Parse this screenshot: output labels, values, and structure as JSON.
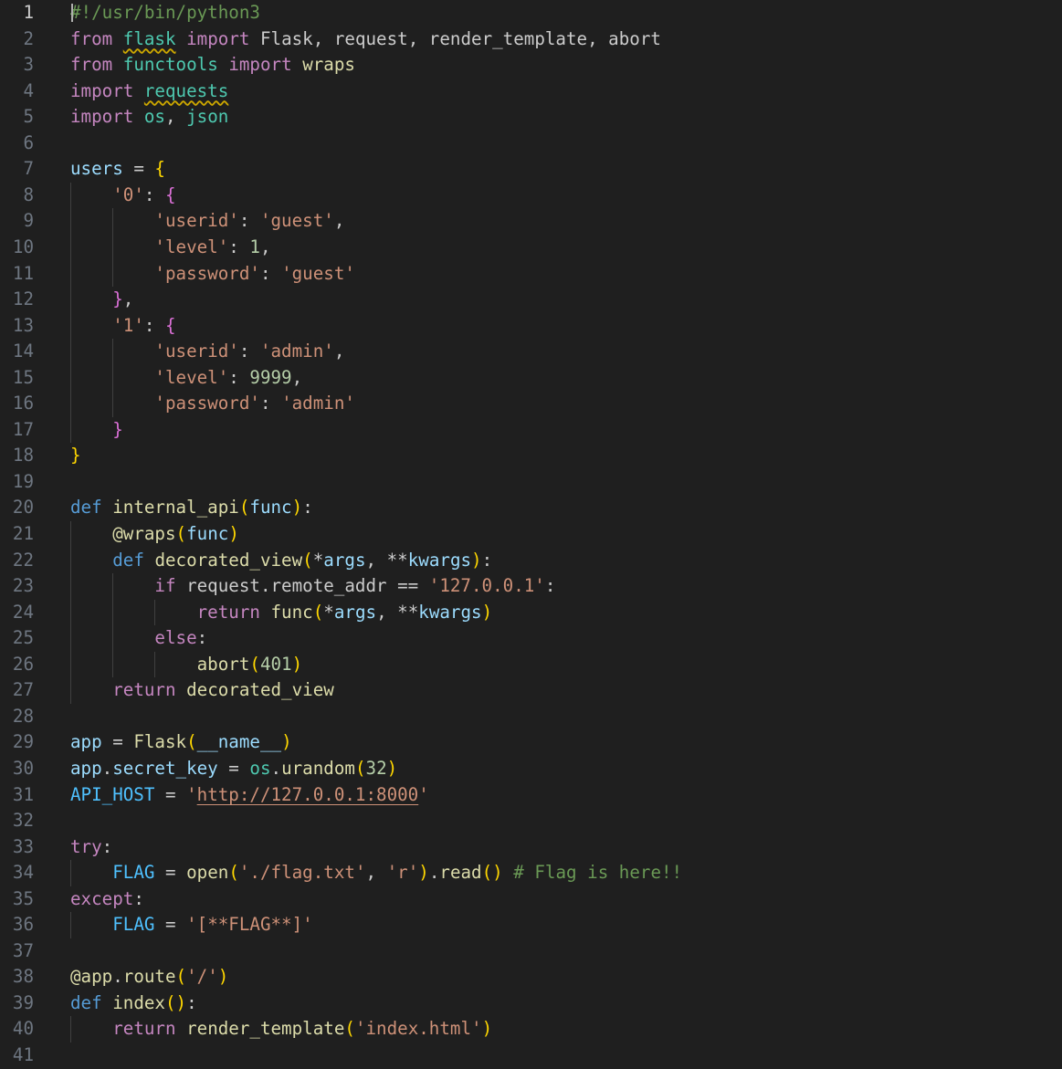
{
  "editor": {
    "language": "python",
    "colors": {
      "background": "#1f1f1f",
      "line_number": "#6e7681",
      "current_line_number": "#cccccc",
      "keyword": "#c586c0",
      "storage": "#569cd6",
      "function": "#dcdcaa",
      "module": "#4ec9b0",
      "variable": "#9cdcfe",
      "string": "#ce9178",
      "number": "#b5cea8",
      "comment": "#6a9955",
      "constant": "#4fc1ff",
      "bracket_level_1": "#ffd700",
      "bracket_level_2": "#da70d6",
      "bracket_level_3": "#179fff",
      "indent_guide": "#404040",
      "warning_squiggle": "#cca700"
    },
    "current_line": 1,
    "lines": [
      {
        "number": "1",
        "tokens": [
          {
            "t": "#!/usr/bin/python3",
            "c": "comment"
          }
        ]
      },
      {
        "number": "2",
        "tokens": [
          {
            "t": "from",
            "c": "keyword"
          },
          {
            "t": " "
          },
          {
            "t": "flask",
            "c": "module",
            "warn": true
          },
          {
            "t": " "
          },
          {
            "t": "import",
            "c": "keyword"
          },
          {
            "t": " Flask, request, render_template, abort"
          }
        ]
      },
      {
        "number": "3",
        "tokens": [
          {
            "t": "from",
            "c": "keyword"
          },
          {
            "t": " "
          },
          {
            "t": "functools",
            "c": "module"
          },
          {
            "t": " "
          },
          {
            "t": "import",
            "c": "keyword"
          },
          {
            "t": " "
          },
          {
            "t": "wraps",
            "c": "function"
          }
        ]
      },
      {
        "number": "4",
        "tokens": [
          {
            "t": "import",
            "c": "keyword"
          },
          {
            "t": " "
          },
          {
            "t": "requests",
            "c": "module",
            "warn": true
          }
        ]
      },
      {
        "number": "5",
        "tokens": [
          {
            "t": "import",
            "c": "keyword"
          },
          {
            "t": " "
          },
          {
            "t": "os",
            "c": "module"
          },
          {
            "t": ", "
          },
          {
            "t": "json",
            "c": "module"
          }
        ]
      },
      {
        "number": "6",
        "tokens": []
      },
      {
        "number": "7",
        "tokens": [
          {
            "t": "users",
            "c": "variable"
          },
          {
            "t": " = "
          },
          {
            "t": "{",
            "c": "brace-1"
          }
        ]
      },
      {
        "number": "8",
        "tokens": [
          {
            "t": "    "
          },
          {
            "t": "'0'",
            "c": "string"
          },
          {
            "t": ": "
          },
          {
            "t": "{",
            "c": "brace-2"
          }
        ]
      },
      {
        "number": "9",
        "tokens": [
          {
            "t": "        "
          },
          {
            "t": "'userid'",
            "c": "string"
          },
          {
            "t": ": "
          },
          {
            "t": "'guest'",
            "c": "string"
          },
          {
            "t": ","
          }
        ]
      },
      {
        "number": "10",
        "tokens": [
          {
            "t": "        "
          },
          {
            "t": "'level'",
            "c": "string"
          },
          {
            "t": ": "
          },
          {
            "t": "1",
            "c": "number"
          },
          {
            "t": ","
          }
        ]
      },
      {
        "number": "11",
        "tokens": [
          {
            "t": "        "
          },
          {
            "t": "'password'",
            "c": "string"
          },
          {
            "t": ": "
          },
          {
            "t": "'guest'",
            "c": "string"
          }
        ]
      },
      {
        "number": "12",
        "tokens": [
          {
            "t": "    "
          },
          {
            "t": "}",
            "c": "brace-2"
          },
          {
            "t": ","
          }
        ]
      },
      {
        "number": "13",
        "tokens": [
          {
            "t": "    "
          },
          {
            "t": "'1'",
            "c": "string"
          },
          {
            "t": ": "
          },
          {
            "t": "{",
            "c": "brace-2"
          }
        ]
      },
      {
        "number": "14",
        "tokens": [
          {
            "t": "        "
          },
          {
            "t": "'userid'",
            "c": "string"
          },
          {
            "t": ": "
          },
          {
            "t": "'admin'",
            "c": "string"
          },
          {
            "t": ","
          }
        ]
      },
      {
        "number": "15",
        "tokens": [
          {
            "t": "        "
          },
          {
            "t": "'level'",
            "c": "string"
          },
          {
            "t": ": "
          },
          {
            "t": "9999",
            "c": "number"
          },
          {
            "t": ","
          }
        ]
      },
      {
        "number": "16",
        "tokens": [
          {
            "t": "        "
          },
          {
            "t": "'password'",
            "c": "string"
          },
          {
            "t": ": "
          },
          {
            "t": "'admin'",
            "c": "string"
          }
        ]
      },
      {
        "number": "17",
        "tokens": [
          {
            "t": "    "
          },
          {
            "t": "}",
            "c": "brace-2"
          }
        ]
      },
      {
        "number": "18",
        "tokens": [
          {
            "t": "}",
            "c": "brace-1"
          }
        ]
      },
      {
        "number": "19",
        "tokens": []
      },
      {
        "number": "20",
        "tokens": [
          {
            "t": "def",
            "c": "storage"
          },
          {
            "t": " "
          },
          {
            "t": "internal_api",
            "c": "function"
          },
          {
            "t": "(",
            "c": "brace-1"
          },
          {
            "t": "func",
            "c": "variable"
          },
          {
            "t": ")",
            "c": "brace-1"
          },
          {
            "t": ":"
          }
        ]
      },
      {
        "number": "21",
        "tokens": [
          {
            "t": "    "
          },
          {
            "t": "@wraps",
            "c": "function"
          },
          {
            "t": "(",
            "c": "brace-1"
          },
          {
            "t": "func",
            "c": "variable"
          },
          {
            "t": ")",
            "c": "brace-1"
          }
        ]
      },
      {
        "number": "22",
        "tokens": [
          {
            "t": "    "
          },
          {
            "t": "def",
            "c": "storage"
          },
          {
            "t": " "
          },
          {
            "t": "decorated_view",
            "c": "function"
          },
          {
            "t": "(",
            "c": "brace-1"
          },
          {
            "t": "*"
          },
          {
            "t": "args",
            "c": "variable"
          },
          {
            "t": ", **"
          },
          {
            "t": "kwargs",
            "c": "variable"
          },
          {
            "t": ")",
            "c": "brace-1"
          },
          {
            "t": ":"
          }
        ]
      },
      {
        "number": "23",
        "tokens": [
          {
            "t": "        "
          },
          {
            "t": "if",
            "c": "keyword"
          },
          {
            "t": " request.remote_addr == "
          },
          {
            "t": "'127.0.0.1'",
            "c": "string"
          },
          {
            "t": ":"
          }
        ]
      },
      {
        "number": "24",
        "tokens": [
          {
            "t": "            "
          },
          {
            "t": "return",
            "c": "keyword"
          },
          {
            "t": " "
          },
          {
            "t": "func",
            "c": "function"
          },
          {
            "t": "(",
            "c": "brace-1"
          },
          {
            "t": "*"
          },
          {
            "t": "args",
            "c": "variable"
          },
          {
            "t": ", **"
          },
          {
            "t": "kwargs",
            "c": "variable"
          },
          {
            "t": ")",
            "c": "brace-1"
          }
        ]
      },
      {
        "number": "25",
        "tokens": [
          {
            "t": "        "
          },
          {
            "t": "else",
            "c": "keyword"
          },
          {
            "t": ":"
          }
        ]
      },
      {
        "number": "26",
        "tokens": [
          {
            "t": "            "
          },
          {
            "t": "abort",
            "c": "function"
          },
          {
            "t": "(",
            "c": "brace-1"
          },
          {
            "t": "401",
            "c": "number"
          },
          {
            "t": ")",
            "c": "brace-1"
          }
        ]
      },
      {
        "number": "27",
        "tokens": [
          {
            "t": "    "
          },
          {
            "t": "return",
            "c": "keyword"
          },
          {
            "t": " "
          },
          {
            "t": "decorated_view",
            "c": "function"
          }
        ]
      },
      {
        "number": "28",
        "tokens": []
      },
      {
        "number": "29",
        "tokens": [
          {
            "t": "app",
            "c": "variable"
          },
          {
            "t": " = "
          },
          {
            "t": "Flask",
            "c": "function"
          },
          {
            "t": "(",
            "c": "brace-1"
          },
          {
            "t": "__name__",
            "c": "variable"
          },
          {
            "t": ")",
            "c": "brace-1"
          }
        ]
      },
      {
        "number": "30",
        "tokens": [
          {
            "t": "app",
            "c": "variable"
          },
          {
            "t": "."
          },
          {
            "t": "secret_key",
            "c": "variable"
          },
          {
            "t": " = "
          },
          {
            "t": "os",
            "c": "module"
          },
          {
            "t": "."
          },
          {
            "t": "urandom",
            "c": "function"
          },
          {
            "t": "(",
            "c": "brace-1"
          },
          {
            "t": "32",
            "c": "number"
          },
          {
            "t": ")",
            "c": "brace-1"
          }
        ]
      },
      {
        "number": "31",
        "tokens": [
          {
            "t": "API_HOST",
            "c": "const"
          },
          {
            "t": " = "
          },
          {
            "t": "'",
            "c": "string"
          },
          {
            "t": "http://127.0.0.1:8000",
            "c": "string",
            "link": true
          },
          {
            "t": "'",
            "c": "string"
          }
        ]
      },
      {
        "number": "32",
        "tokens": []
      },
      {
        "number": "33",
        "tokens": [
          {
            "t": "try",
            "c": "keyword"
          },
          {
            "t": ":"
          }
        ]
      },
      {
        "number": "34",
        "tokens": [
          {
            "t": "    "
          },
          {
            "t": "FLAG",
            "c": "const"
          },
          {
            "t": " = "
          },
          {
            "t": "open",
            "c": "function"
          },
          {
            "t": "(",
            "c": "brace-1"
          },
          {
            "t": "'./flag.txt'",
            "c": "string"
          },
          {
            "t": ", "
          },
          {
            "t": "'r'",
            "c": "string"
          },
          {
            "t": ")",
            "c": "brace-1"
          },
          {
            "t": "."
          },
          {
            "t": "read",
            "c": "function"
          },
          {
            "t": "()",
            "c": "brace-1"
          },
          {
            "t": " "
          },
          {
            "t": "# Flag is here!!",
            "c": "comment"
          }
        ]
      },
      {
        "number": "35",
        "tokens": [
          {
            "t": "except",
            "c": "keyword"
          },
          {
            "t": ":"
          }
        ]
      },
      {
        "number": "36",
        "tokens": [
          {
            "t": "    "
          },
          {
            "t": "FLAG",
            "c": "const"
          },
          {
            "t": " = "
          },
          {
            "t": "'[**FLAG**]'",
            "c": "string"
          }
        ]
      },
      {
        "number": "37",
        "tokens": []
      },
      {
        "number": "38",
        "tokens": [
          {
            "t": "@app",
            "c": "function"
          },
          {
            "t": "."
          },
          {
            "t": "route",
            "c": "function"
          },
          {
            "t": "(",
            "c": "brace-1"
          },
          {
            "t": "'/'",
            "c": "string"
          },
          {
            "t": ")",
            "c": "brace-1"
          }
        ]
      },
      {
        "number": "39",
        "tokens": [
          {
            "t": "def",
            "c": "storage"
          },
          {
            "t": " "
          },
          {
            "t": "index",
            "c": "function"
          },
          {
            "t": "()",
            "c": "brace-1"
          },
          {
            "t": ":"
          }
        ]
      },
      {
        "number": "40",
        "tokens": [
          {
            "t": "    "
          },
          {
            "t": "return",
            "c": "keyword"
          },
          {
            "t": " "
          },
          {
            "t": "render_template",
            "c": "function"
          },
          {
            "t": "(",
            "c": "brace-1"
          },
          {
            "t": "'index.html'",
            "c": "string"
          },
          {
            "t": ")",
            "c": "brace-1"
          }
        ]
      },
      {
        "number": "41",
        "tokens": []
      }
    ]
  }
}
